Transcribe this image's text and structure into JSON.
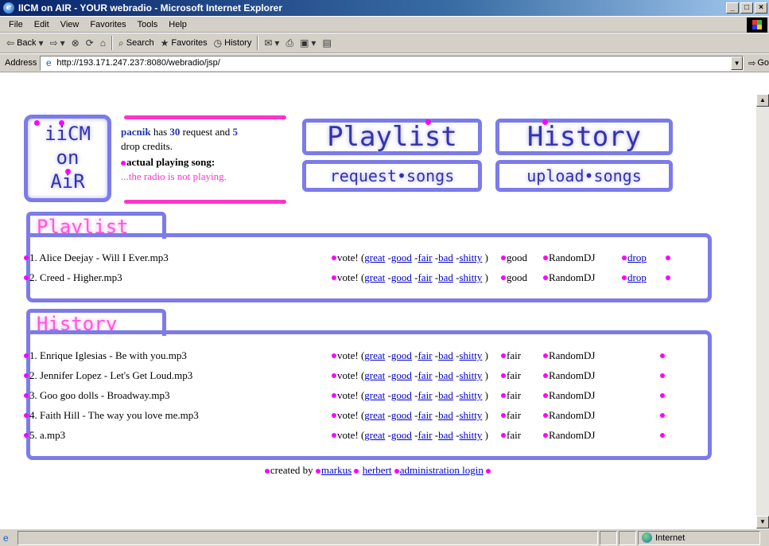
{
  "window": {
    "title": "IICM on AIR - YOUR webradio - Microsoft Internet Explorer",
    "controls": [
      "_",
      "□",
      "×"
    ]
  },
  "menu": [
    "File",
    "Edit",
    "View",
    "Favorites",
    "Tools",
    "Help"
  ],
  "toolbar": {
    "back": "Back",
    "search": "Search",
    "favorites": "Favorites",
    "history": "History"
  },
  "address": {
    "label": "Address",
    "url": "http://193.171.247.237:8080/webradio/jsp/",
    "go": "Go"
  },
  "logo": {
    "line1": "iiCM",
    "line2": "on",
    "line3": "AiR"
  },
  "info": {
    "user": "pacnik",
    "has": "has",
    "request_credits": "30",
    "request_and": "request and",
    "drop_credits": "5",
    "drop_text": "drop credits.",
    "playing_label": "actual playing song:",
    "playing_value": "...the radio is not playing."
  },
  "nav": {
    "playlist": "Playlist",
    "history": "History",
    "request": "request•songs",
    "upload": "upload•songs"
  },
  "playlist": {
    "heading": "Playlist",
    "rows": [
      {
        "title": "1. Alice Deejay - Will I Ever.mp3",
        "rating": "good",
        "dj": "RandomDJ",
        "drop": "drop"
      },
      {
        "title": "2. Creed - Higher.mp3",
        "rating": "good",
        "dj": "RandomDJ",
        "drop": "drop"
      }
    ]
  },
  "history": {
    "heading": "History",
    "rows": [
      {
        "title": "1. Enrique Iglesias - Be with you.mp3",
        "rating": "fair",
        "dj": "RandomDJ"
      },
      {
        "title": "2. Jennifer Lopez - Let's Get Loud.mp3",
        "rating": "fair",
        "dj": "RandomDJ"
      },
      {
        "title": "3. Goo goo dolls - Broadway.mp3",
        "rating": "fair",
        "dj": "RandomDJ"
      },
      {
        "title": "4. Faith Hill - The way you love me.mp3",
        "rating": "fair",
        "dj": "RandomDJ"
      },
      {
        "title": "5. a.mp3",
        "rating": "fair",
        "dj": "RandomDJ"
      }
    ]
  },
  "vote": {
    "label": "vote! (",
    "close": ")",
    "great": "great",
    "good": "good",
    "fair": "fair",
    "bad": "bad",
    "shitty": "shitty"
  },
  "footer": {
    "created_by": "created by",
    "author1": "markus",
    "author2": "herbert",
    "admin": "administration login"
  },
  "status": {
    "zone": "Internet"
  },
  "colors": {
    "frame": "#7b7bea",
    "accent_pink": "#ff00ff",
    "link": "#0000cc"
  }
}
